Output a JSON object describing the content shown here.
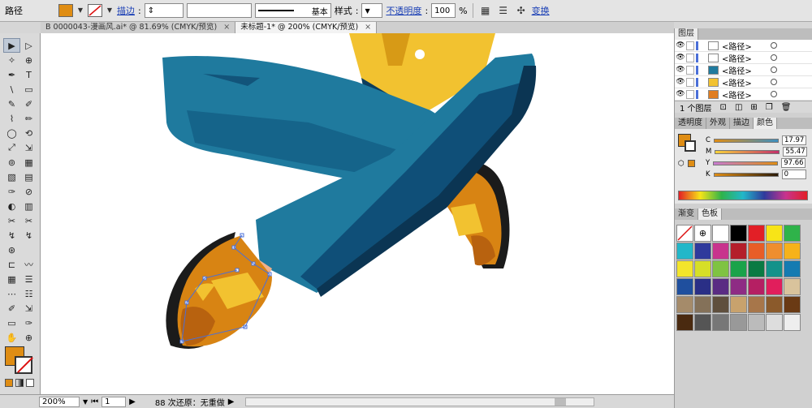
{
  "control_bar": {
    "object_type": "路径",
    "fill_color": "#df8d14",
    "stroke_label": "描边",
    "stroke_weight": "",
    "brush_value": "",
    "stroke_profile": "基本",
    "style_label": "样式",
    "opacity_label": "不透明度",
    "opacity_value": "100",
    "opacity_unit": "%",
    "transform_label": "变换"
  },
  "tabs": [
    {
      "label": "B 0000043-漫画风.ai* @ 81.69% (CMYK/预览)",
      "close": "×"
    },
    {
      "label": "未标题-1* @ 200% (CMYK/预览)",
      "close": "×"
    }
  ],
  "toolbox": {
    "tools": [
      "▶",
      "▷",
      "✧",
      "⊕",
      "✒",
      "T",
      "\\",
      "▭",
      "✎",
      "✐",
      "⌇",
      "✏",
      "◯",
      "⟲",
      "⤢",
      "⇲",
      "⊚",
      "▦",
      "▧",
      "▤",
      "✑",
      "⊘",
      "◐",
      "▥",
      "✂",
      "✂",
      "↯",
      "↯",
      "⊛",
      "",
      "⊏",
      "〰",
      "▦",
      "☰",
      "⋯",
      "☷",
      "✐",
      "⇲",
      "▭",
      "✑",
      "✋",
      "⊕"
    ],
    "fill_color": "#df8d14"
  },
  "status": {
    "zoom": "200%",
    "page": "1",
    "message": "88 次还原：无重做"
  },
  "layers_panel": {
    "tab_label": "图层",
    "rows": [
      {
        "name": "<路径>",
        "thumb_color": "#ffffff"
      },
      {
        "name": "<路径>",
        "thumb_color": "#ffffff"
      },
      {
        "name": "<路径>",
        "thumb_color": "#1f7a9e"
      },
      {
        "name": "<路径>",
        "thumb_color": "#f2c230"
      },
      {
        "name": "<路径>",
        "thumb_color": "#e07d20"
      }
    ],
    "footer": "1 个图层"
  },
  "color_panel": {
    "tabs": [
      "透明度",
      "外观",
      "描边",
      "颜色"
    ],
    "active_tab": 3,
    "fill_color": "#df8d14",
    "C_label": "C",
    "C_value": "17.97",
    "M_label": "M",
    "M_value": "55.47",
    "Y_label": "Y",
    "Y_value": "97.66",
    "K_label": "K",
    "K_value": "0"
  },
  "swatches_panel": {
    "tabs": [
      "渐变",
      "色板"
    ],
    "swatches": [
      "#ffffff",
      "#ffffff",
      "#ffffff",
      "#000000",
      "#e21f26",
      "#f7e417",
      "#2fb34a",
      "#22b7c9",
      "#2f3a9c",
      "#c8338d",
      "#b41f2a",
      "#e85d27",
      "#ef8e2e",
      "#f6b21a",
      "#f3e52b",
      "#d6df27",
      "#7fc342",
      "#1aa34a",
      "#0a7a43",
      "#13928a",
      "#157bb1",
      "#1f4f9e",
      "#2a2f86",
      "#5a2c83",
      "#8e2c84",
      "#b51f63",
      "#e11e5c",
      "#d9c39c",
      "#a58b6a",
      "#847159",
      "#5f4f3d",
      "#c8a26d",
      "#a7764a",
      "#8b5a2b",
      "#6a3a14",
      "#4a2a10",
      "#555555",
      "#777777",
      "#999999",
      "#bbbbbb",
      "#dddddd",
      "#eeeeee"
    ]
  }
}
